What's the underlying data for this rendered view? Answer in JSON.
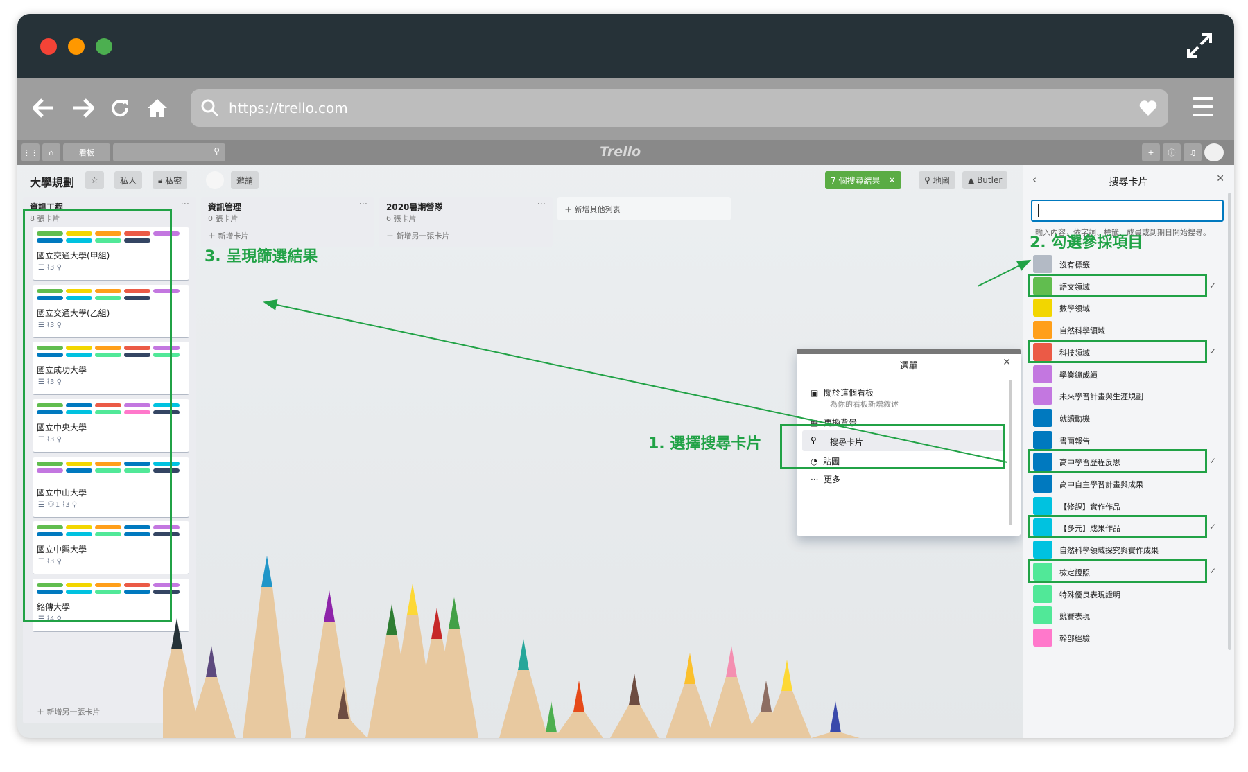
{
  "browser": {
    "url": "https://trello.com"
  },
  "trello": {
    "logo": "Trello",
    "topbar_boards": "看板",
    "board_title": "大學規劃",
    "visibility_personal": "私人",
    "privacy_private": "私密",
    "invite": "邀請",
    "filter_results": "7 個搜尋結果",
    "map": "地圖",
    "butler": "Butler",
    "lists": [
      {
        "title": "資訊工程",
        "count": "8 張卡片",
        "add": "新增另一張卡片"
      },
      {
        "title": "資訊管理",
        "count": "0 張卡片",
        "add": "新增卡片"
      },
      {
        "title": "2020暑期營隊",
        "count": "6 張卡片",
        "add": "新增另一張卡片"
      }
    ],
    "add_list": "新增其他列表",
    "cards": [
      {
        "title": "國立交通大學(甲組)",
        "attach": "3"
      },
      {
        "title": "國立交通大學(乙組)",
        "attach": "3"
      },
      {
        "title": "國立成功大學",
        "attach": "3"
      },
      {
        "title": "國立中央大學",
        "attach": "3"
      },
      {
        "title": "國立中山大學",
        "comments": "1",
        "attach": "3"
      },
      {
        "title": "國立中興大學",
        "attach": "3"
      },
      {
        "title": "銘傳大學",
        "attach": "4"
      }
    ],
    "menu": {
      "title": "選單",
      "about": "關於這個看板",
      "about_desc": "為你的看板新增敘述",
      "change_bg": "更換背景",
      "search": "搜尋卡片",
      "stickers": "貼圖",
      "more": "更多"
    },
    "search_panel": {
      "title": "搜尋卡片",
      "hint": "輸入內容，依字詞、標籤、成員或到期日開始搜尋。",
      "labels": [
        {
          "name": "沒有標籤",
          "color": "#b3bac5",
          "checked": ""
        },
        {
          "name": "語文領域",
          "color": "#61bd4f",
          "checked": "✓"
        },
        {
          "name": "數學領域",
          "color": "#f2d600",
          "checked": ""
        },
        {
          "name": "自然科學領域",
          "color": "#ff9f1a",
          "checked": ""
        },
        {
          "name": "科技領域",
          "color": "#eb5a46",
          "checked": "✓"
        },
        {
          "name": "學業總成績",
          "color": "#c377e0",
          "checked": ""
        },
        {
          "name": "未來學習計畫與生涯規劃",
          "color": "#c377e0",
          "checked": ""
        },
        {
          "name": "就讀動機",
          "color": "#0079bf",
          "checked": ""
        },
        {
          "name": "書面報告",
          "color": "#0079bf",
          "checked": ""
        },
        {
          "name": "高中學習歷程反思",
          "color": "#0079bf",
          "checked": "✓"
        },
        {
          "name": "高中自主學習計畫與成果",
          "color": "#0079bf",
          "checked": ""
        },
        {
          "name": "【修課】實作作品",
          "color": "#00c2e0",
          "checked": ""
        },
        {
          "name": "【多元】成果作品",
          "color": "#00c2e0",
          "checked": "✓"
        },
        {
          "name": "自然科學領域探究與實作成果",
          "color": "#00c2e0",
          "checked": ""
        },
        {
          "name": "檢定證照",
          "color": "#51e898",
          "checked": "✓"
        },
        {
          "name": "特殊優良表現證明",
          "color": "#51e898",
          "checked": ""
        },
        {
          "name": "競賽表現",
          "color": "#51e898",
          "checked": ""
        },
        {
          "name": "幹部經驗",
          "color": "#ff78cb",
          "checked": ""
        }
      ]
    }
  },
  "annotations": {
    "step1": "1. 選擇搜尋卡片",
    "step2": "2. 勾選參採項目",
    "step3": "3. 呈現篩選結果"
  }
}
